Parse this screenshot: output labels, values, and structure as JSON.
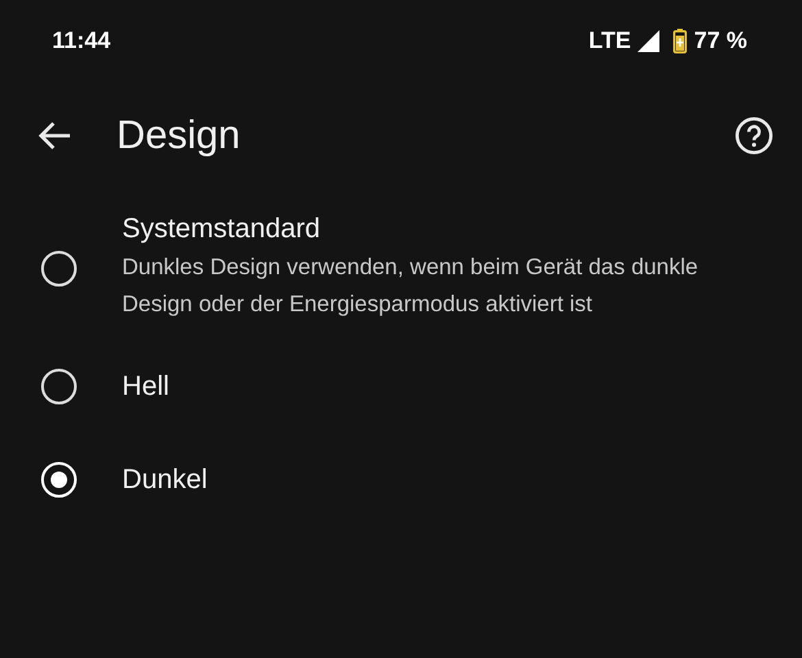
{
  "status_bar": {
    "time": "11:44",
    "network": "LTE",
    "battery": "77 %"
  },
  "toolbar": {
    "title": "Design"
  },
  "options": [
    {
      "label": "Systemstandard",
      "description": "Dunkles Design verwenden, wenn beim Gerät das dunkle Design oder der Energiesparmodus aktiviert ist",
      "selected": false
    },
    {
      "label": "Hell",
      "selected": false
    },
    {
      "label": "Dunkel",
      "selected": true
    }
  ]
}
